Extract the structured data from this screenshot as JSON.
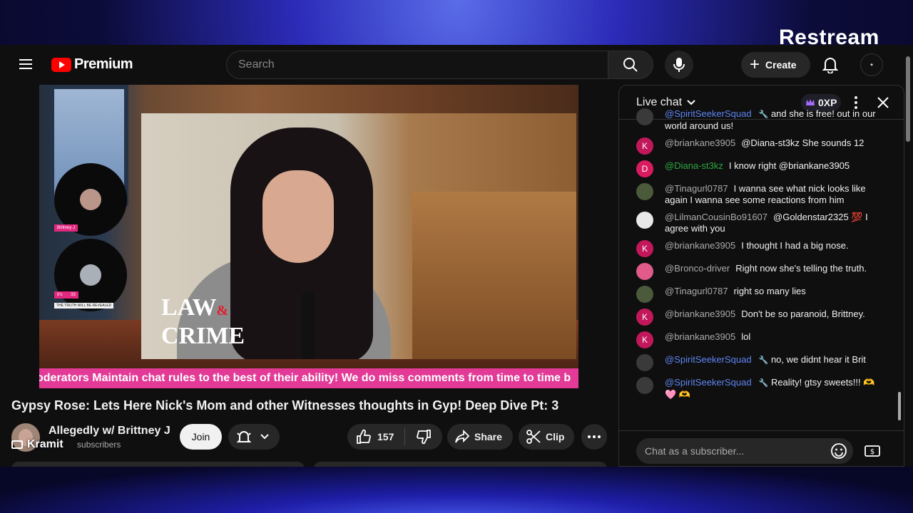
{
  "overlay": {
    "brand": "Restream"
  },
  "header": {
    "logo_text": "Premium",
    "search_placeholder": "Search",
    "create_label": "Create"
  },
  "video": {
    "ticker_text": "oderators Maintain chat rules to the best of their ability! We do miss comments from time to time b",
    "law_text": "LAW",
    "amp_text": "&",
    "crime_text": "CRIME",
    "host_tag_1": "Brittney J",
    "host_tag_2": "It's       33",
    "host_tag_3": "THE TRUTH WILL BE REVEALED"
  },
  "info": {
    "title": "Gypsy Rose: Lets Here Nick's Mom and other Witnesses thoughts in Gyp! Deep Dive Pt: 3",
    "channel_name": "Allegedly w/ Brittney J",
    "subscribers": "subscribers",
    "cast_label": "Kramit",
    "join_label": "Join",
    "like_count": "157",
    "share_label": "Share",
    "clip_label": "Clip"
  },
  "chat": {
    "title": "Live chat",
    "xp_label": "0XP",
    "input_placeholder": "Chat as a subscriber...",
    "messages": [
      {
        "author": "@SpiritSeekerSquad",
        "text": "and she is free! out in our world around us!",
        "avatar_letter": "",
        "avatar_color": "#3a3a3a",
        "role": "mod"
      },
      {
        "author": "@briankane3905",
        "text": "@Diana-st3kz She sounds 12",
        "avatar_letter": "K",
        "avatar_color": "#c2185b",
        "role": ""
      },
      {
        "author": "@Diana-st3kz",
        "text": "I know right @briankane3905",
        "avatar_letter": "D",
        "avatar_color": "#d81b60",
        "role": "member"
      },
      {
        "author": "@Tinagurl0787",
        "text": "I wanna see what nick looks like again I wanna see some reactions from him",
        "avatar_letter": "",
        "avatar_color": "#4a5a3a",
        "role": ""
      },
      {
        "author": "@LilmanCousinBo91607",
        "text": "@Goldenstar2325 💯 I agree with you",
        "avatar_letter": "",
        "avatar_color": "#e8e8e8",
        "role": ""
      },
      {
        "author": "@briankane3905",
        "text": "I thought I had a big nose.",
        "avatar_letter": "K",
        "avatar_color": "#c2185b",
        "role": ""
      },
      {
        "author": "@Bronco-driver",
        "text": "Right now she's telling the truth.",
        "avatar_letter": "",
        "avatar_color": "#e05a8a",
        "role": ""
      },
      {
        "author": "@Tinagurl0787",
        "text": "right so many lies",
        "avatar_letter": "",
        "avatar_color": "#4a5a3a",
        "role": ""
      },
      {
        "author": "@briankane3905",
        "text": "Don't be so paranoid, Brittney.",
        "avatar_letter": "K",
        "avatar_color": "#c2185b",
        "role": ""
      },
      {
        "author": "@briankane3905",
        "text": "lol",
        "avatar_letter": "K",
        "avatar_color": "#c2185b",
        "role": ""
      },
      {
        "author": "@SpiritSeekerSquad",
        "text": "no, we didnt hear it Brit",
        "avatar_letter": "",
        "avatar_color": "#3a3a3a",
        "role": "mod"
      },
      {
        "author": "@SpiritSeekerSquad",
        "text": "Reality! gtsy sweets!!! 🫶 🩷 🫶",
        "avatar_letter": "",
        "avatar_color": "#3a3a3a",
        "role": "mod"
      }
    ]
  },
  "colors": {
    "brand_red": "#ff0000",
    "ticker_pink": "#e23a96",
    "mod_blue": "#5e84f1",
    "member_green": "#2ba640"
  }
}
